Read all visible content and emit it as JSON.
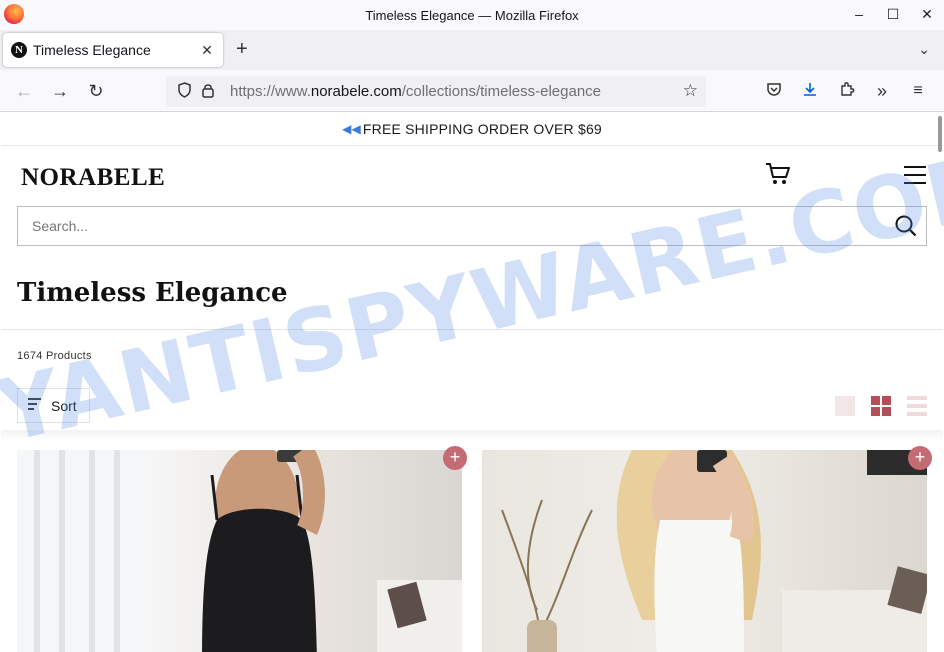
{
  "window": {
    "title": "Timeless Elegance — Mozilla Firefox"
  },
  "tab": {
    "title": "Timeless Elegance",
    "favicon_letter": "N"
  },
  "urlbar": {
    "prefix": "https://www.",
    "domain": "norabele.com",
    "path": "/collections/timeless-elegance"
  },
  "promo": {
    "text": "FREE SHIPPING ORDER OVER $69"
  },
  "store": {
    "logo": "NORABELE",
    "search_placeholder": "Search..."
  },
  "collection": {
    "title": "Timeless Elegance",
    "count": "1674 Products",
    "sort_label": "Sort"
  },
  "watermark": {
    "text": "MYANTISPYWARE.COM",
    "color": "#5b8ee6"
  },
  "colors": {
    "accent": "#c46b73",
    "grid_active": "#b34f56"
  },
  "icons": [
    "firefox-icon",
    "back-icon",
    "forward-icon",
    "reload-icon",
    "shield-icon",
    "lock-icon",
    "star-icon",
    "pocket-icon",
    "download-icon",
    "extensions-icon",
    "overflow-icon",
    "hamburger-icon",
    "cart-icon",
    "menu-icon",
    "search-icon",
    "plus-icon"
  ]
}
